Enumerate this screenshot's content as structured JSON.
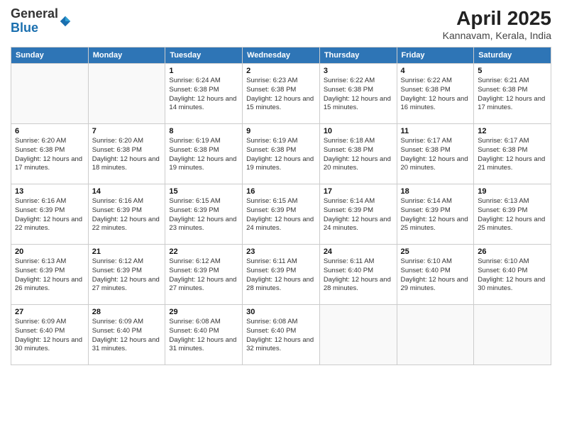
{
  "logo": {
    "general": "General",
    "blue": "Blue"
  },
  "title": "April 2025",
  "subtitle": "Kannavam, Kerala, India",
  "headers": [
    "Sunday",
    "Monday",
    "Tuesday",
    "Wednesday",
    "Thursday",
    "Friday",
    "Saturday"
  ],
  "weeks": [
    [
      {
        "day": "",
        "sunrise": "",
        "sunset": "",
        "daylight": ""
      },
      {
        "day": "",
        "sunrise": "",
        "sunset": "",
        "daylight": ""
      },
      {
        "day": "1",
        "sunrise": "Sunrise: 6:24 AM",
        "sunset": "Sunset: 6:38 PM",
        "daylight": "Daylight: 12 hours and 14 minutes."
      },
      {
        "day": "2",
        "sunrise": "Sunrise: 6:23 AM",
        "sunset": "Sunset: 6:38 PM",
        "daylight": "Daylight: 12 hours and 15 minutes."
      },
      {
        "day": "3",
        "sunrise": "Sunrise: 6:22 AM",
        "sunset": "Sunset: 6:38 PM",
        "daylight": "Daylight: 12 hours and 15 minutes."
      },
      {
        "day": "4",
        "sunrise": "Sunrise: 6:22 AM",
        "sunset": "Sunset: 6:38 PM",
        "daylight": "Daylight: 12 hours and 16 minutes."
      },
      {
        "day": "5",
        "sunrise": "Sunrise: 6:21 AM",
        "sunset": "Sunset: 6:38 PM",
        "daylight": "Daylight: 12 hours and 17 minutes."
      }
    ],
    [
      {
        "day": "6",
        "sunrise": "Sunrise: 6:20 AM",
        "sunset": "Sunset: 6:38 PM",
        "daylight": "Daylight: 12 hours and 17 minutes."
      },
      {
        "day": "7",
        "sunrise": "Sunrise: 6:20 AM",
        "sunset": "Sunset: 6:38 PM",
        "daylight": "Daylight: 12 hours and 18 minutes."
      },
      {
        "day": "8",
        "sunrise": "Sunrise: 6:19 AM",
        "sunset": "Sunset: 6:38 PM",
        "daylight": "Daylight: 12 hours and 19 minutes."
      },
      {
        "day": "9",
        "sunrise": "Sunrise: 6:19 AM",
        "sunset": "Sunset: 6:38 PM",
        "daylight": "Daylight: 12 hours and 19 minutes."
      },
      {
        "day": "10",
        "sunrise": "Sunrise: 6:18 AM",
        "sunset": "Sunset: 6:38 PM",
        "daylight": "Daylight: 12 hours and 20 minutes."
      },
      {
        "day": "11",
        "sunrise": "Sunrise: 6:17 AM",
        "sunset": "Sunset: 6:38 PM",
        "daylight": "Daylight: 12 hours and 20 minutes."
      },
      {
        "day": "12",
        "sunrise": "Sunrise: 6:17 AM",
        "sunset": "Sunset: 6:38 PM",
        "daylight": "Daylight: 12 hours and 21 minutes."
      }
    ],
    [
      {
        "day": "13",
        "sunrise": "Sunrise: 6:16 AM",
        "sunset": "Sunset: 6:39 PM",
        "daylight": "Daylight: 12 hours and 22 minutes."
      },
      {
        "day": "14",
        "sunrise": "Sunrise: 6:16 AM",
        "sunset": "Sunset: 6:39 PM",
        "daylight": "Daylight: 12 hours and 22 minutes."
      },
      {
        "day": "15",
        "sunrise": "Sunrise: 6:15 AM",
        "sunset": "Sunset: 6:39 PM",
        "daylight": "Daylight: 12 hours and 23 minutes."
      },
      {
        "day": "16",
        "sunrise": "Sunrise: 6:15 AM",
        "sunset": "Sunset: 6:39 PM",
        "daylight": "Daylight: 12 hours and 24 minutes."
      },
      {
        "day": "17",
        "sunrise": "Sunrise: 6:14 AM",
        "sunset": "Sunset: 6:39 PM",
        "daylight": "Daylight: 12 hours and 24 minutes."
      },
      {
        "day": "18",
        "sunrise": "Sunrise: 6:14 AM",
        "sunset": "Sunset: 6:39 PM",
        "daylight": "Daylight: 12 hours and 25 minutes."
      },
      {
        "day": "19",
        "sunrise": "Sunrise: 6:13 AM",
        "sunset": "Sunset: 6:39 PM",
        "daylight": "Daylight: 12 hours and 25 minutes."
      }
    ],
    [
      {
        "day": "20",
        "sunrise": "Sunrise: 6:13 AM",
        "sunset": "Sunset: 6:39 PM",
        "daylight": "Daylight: 12 hours and 26 minutes."
      },
      {
        "day": "21",
        "sunrise": "Sunrise: 6:12 AM",
        "sunset": "Sunset: 6:39 PM",
        "daylight": "Daylight: 12 hours and 27 minutes."
      },
      {
        "day": "22",
        "sunrise": "Sunrise: 6:12 AM",
        "sunset": "Sunset: 6:39 PM",
        "daylight": "Daylight: 12 hours and 27 minutes."
      },
      {
        "day": "23",
        "sunrise": "Sunrise: 6:11 AM",
        "sunset": "Sunset: 6:39 PM",
        "daylight": "Daylight: 12 hours and 28 minutes."
      },
      {
        "day": "24",
        "sunrise": "Sunrise: 6:11 AM",
        "sunset": "Sunset: 6:40 PM",
        "daylight": "Daylight: 12 hours and 28 minutes."
      },
      {
        "day": "25",
        "sunrise": "Sunrise: 6:10 AM",
        "sunset": "Sunset: 6:40 PM",
        "daylight": "Daylight: 12 hours and 29 minutes."
      },
      {
        "day": "26",
        "sunrise": "Sunrise: 6:10 AM",
        "sunset": "Sunset: 6:40 PM",
        "daylight": "Daylight: 12 hours and 30 minutes."
      }
    ],
    [
      {
        "day": "27",
        "sunrise": "Sunrise: 6:09 AM",
        "sunset": "Sunset: 6:40 PM",
        "daylight": "Daylight: 12 hours and 30 minutes."
      },
      {
        "day": "28",
        "sunrise": "Sunrise: 6:09 AM",
        "sunset": "Sunset: 6:40 PM",
        "daylight": "Daylight: 12 hours and 31 minutes."
      },
      {
        "day": "29",
        "sunrise": "Sunrise: 6:08 AM",
        "sunset": "Sunset: 6:40 PM",
        "daylight": "Daylight: 12 hours and 31 minutes."
      },
      {
        "day": "30",
        "sunrise": "Sunrise: 6:08 AM",
        "sunset": "Sunset: 6:40 PM",
        "daylight": "Daylight: 12 hours and 32 minutes."
      },
      {
        "day": "",
        "sunrise": "",
        "sunset": "",
        "daylight": ""
      },
      {
        "day": "",
        "sunrise": "",
        "sunset": "",
        "daylight": ""
      },
      {
        "day": "",
        "sunrise": "",
        "sunset": "",
        "daylight": ""
      }
    ]
  ]
}
